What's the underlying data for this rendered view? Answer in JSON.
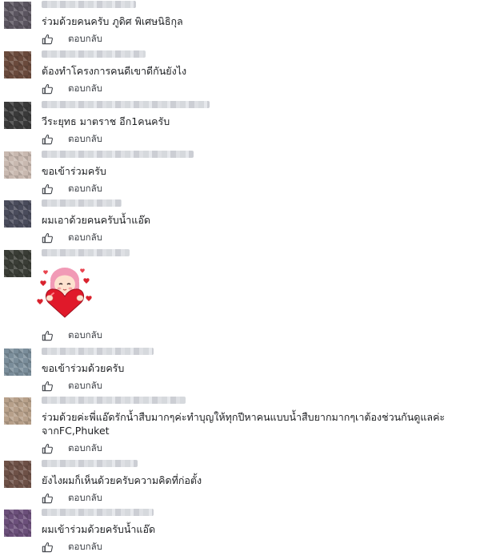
{
  "reply_label": "ตอบกลับ",
  "colors": {
    "text": "#1c1e21",
    "action": "#3b3f45",
    "background": "#ffffff"
  },
  "comments": [
    {
      "text": "ร่วมด้วยคนครับ ภูดิศ พิเศษนิธิกุล",
      "avatar_color": "#5b5560"
    },
    {
      "text": "ต้องทำโครงการคนดีเขาดีกันยังไง",
      "avatar_color": "#6a4a3c"
    },
    {
      "text": "วีระยุทธ มาตราช อีก1คนครับ",
      "avatar_color": "#3a3a3a"
    },
    {
      "text": "ขอเข้าร่วมครับ",
      "avatar_color": "#c9b9b0"
    },
    {
      "text": "ผมเอาด้วยคนครับน้ำแอ๊ด",
      "avatar_color": "#4a4c5c"
    },
    {
      "text": "",
      "avatar_color": "#3a3d36",
      "sticker": "girl-holding-heart-sticker"
    },
    {
      "text": "ขอเข้าร่วมด้วยครับ",
      "avatar_color": "#7a8d9a"
    },
    {
      "text": "ร่วมด้วยค่ะพี่แอ๊ดรักน้ำสืบมากๆค่ะทำบุญให้ทุกปีหาคนแบบน้ำสืบยากมากๆเาต้องช่วนกันดูแลค่ะจากFC,Phuket",
      "avatar_color": "#b7a08a"
    },
    {
      "text": "ยังไงผมก็เห็นด้วยครับความคิดที่ก่อตั้ง",
      "avatar_color": "#6e5147"
    },
    {
      "text": "ผมเข้าร่วมด้วยครับน้ำแอ๊ด",
      "avatar_color": "#6b4f7a"
    }
  ]
}
